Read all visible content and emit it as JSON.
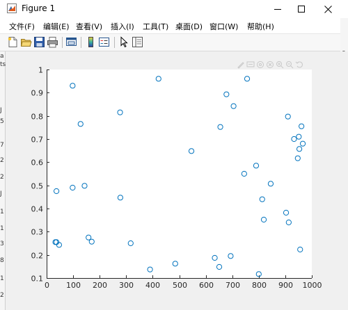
{
  "window": {
    "title": "Figure 1",
    "buttons": {
      "minimize": "minimize",
      "maximize": "maximize",
      "close": "close"
    }
  },
  "menubar": {
    "items": [
      {
        "label": "文件(F)"
      },
      {
        "label": "编辑(E)"
      },
      {
        "label": "查看(V)"
      },
      {
        "label": "插入(I)"
      },
      {
        "label": "工具(T)"
      },
      {
        "label": "桌面(D)"
      },
      {
        "label": "窗口(W)"
      },
      {
        "label": "帮助(H)"
      }
    ]
  },
  "toolbar": {
    "icons": [
      "new-figure-icon",
      "open-file-icon",
      "save-icon",
      "print-icon",
      "link-plot-icon",
      "insert-colorbar-icon",
      "insert-legend-icon",
      "edit-plot-arrow-icon",
      "property-inspector-icon"
    ]
  },
  "axes_toolbar": {
    "icons": [
      "brush-icon",
      "datatip-icon",
      "rotate-icon",
      "pan-icon",
      "zoom-in-icon",
      "zoom-out-icon",
      "restore-view-icon"
    ]
  },
  "left_edge_chars": [
    "a",
    "ts",
    "J",
    "5",
    "7",
    "2",
    "2",
    "J",
    "1",
    "1",
    "3",
    "8",
    "1",
    "2"
  ],
  "right_edge_chars": [
    "e",
    "is"
  ],
  "colors": {
    "marker": "#0072bd",
    "axis": "#262626",
    "axes_bg": "#ffffff",
    "figure_bg": "#f0f0f0"
  },
  "chart_data": {
    "type": "scatter",
    "title": "",
    "xlabel": "",
    "ylabel": "",
    "xlim": [
      0,
      1000
    ],
    "ylim": [
      0.1,
      1
    ],
    "xticks": [
      0,
      100,
      200,
      300,
      400,
      500,
      600,
      700,
      800,
      900,
      1000
    ],
    "xtick_labels": [
      "0",
      "100",
      "200",
      "300",
      "400",
      "500",
      "600",
      "700",
      "800",
      "900",
      "1000"
    ],
    "yticks": [
      0.1,
      0.2,
      0.3,
      0.4,
      0.5,
      0.6,
      0.7,
      0.8,
      0.9,
      1
    ],
    "ytick_labels": [
      "0.1",
      "0.2",
      "0.3",
      "0.4",
      "0.5",
      "0.6",
      "0.7",
      "0.8",
      "0.9",
      "1"
    ],
    "grid": false,
    "marker": "open-circle",
    "points": [
      {
        "x": 33,
        "y": 0.255
      },
      {
        "x": 37,
        "y": 0.475
      },
      {
        "x": 37,
        "y": 0.255
      },
      {
        "x": 47,
        "y": 0.243
      },
      {
        "x": 98,
        "y": 0.93
      },
      {
        "x": 98,
        "y": 0.49
      },
      {
        "x": 128,
        "y": 0.765
      },
      {
        "x": 143,
        "y": 0.498
      },
      {
        "x": 158,
        "y": 0.275
      },
      {
        "x": 170,
        "y": 0.257
      },
      {
        "x": 277,
        "y": 0.815
      },
      {
        "x": 278,
        "y": 0.447
      },
      {
        "x": 317,
        "y": 0.25
      },
      {
        "x": 390,
        "y": 0.137
      },
      {
        "x": 422,
        "y": 0.96
      },
      {
        "x": 485,
        "y": 0.162
      },
      {
        "x": 546,
        "y": 0.648
      },
      {
        "x": 634,
        "y": 0.187
      },
      {
        "x": 651,
        "y": 0.148
      },
      {
        "x": 655,
        "y": 0.752
      },
      {
        "x": 678,
        "y": 0.893
      },
      {
        "x": 694,
        "y": 0.195
      },
      {
        "x": 705,
        "y": 0.842
      },
      {
        "x": 745,
        "y": 0.55
      },
      {
        "x": 756,
        "y": 0.96
      },
      {
        "x": 790,
        "y": 0.585
      },
      {
        "x": 800,
        "y": 0.117
      },
      {
        "x": 813,
        "y": 0.44
      },
      {
        "x": 819,
        "y": 0.352
      },
      {
        "x": 845,
        "y": 0.507
      },
      {
        "x": 903,
        "y": 0.382
      },
      {
        "x": 910,
        "y": 0.797
      },
      {
        "x": 913,
        "y": 0.34
      },
      {
        "x": 933,
        "y": 0.7
      },
      {
        "x": 947,
        "y": 0.617
      },
      {
        "x": 951,
        "y": 0.71
      },
      {
        "x": 953,
        "y": 0.657
      },
      {
        "x": 956,
        "y": 0.223
      },
      {
        "x": 961,
        "y": 0.755
      },
      {
        "x": 966,
        "y": 0.68
      }
    ]
  }
}
